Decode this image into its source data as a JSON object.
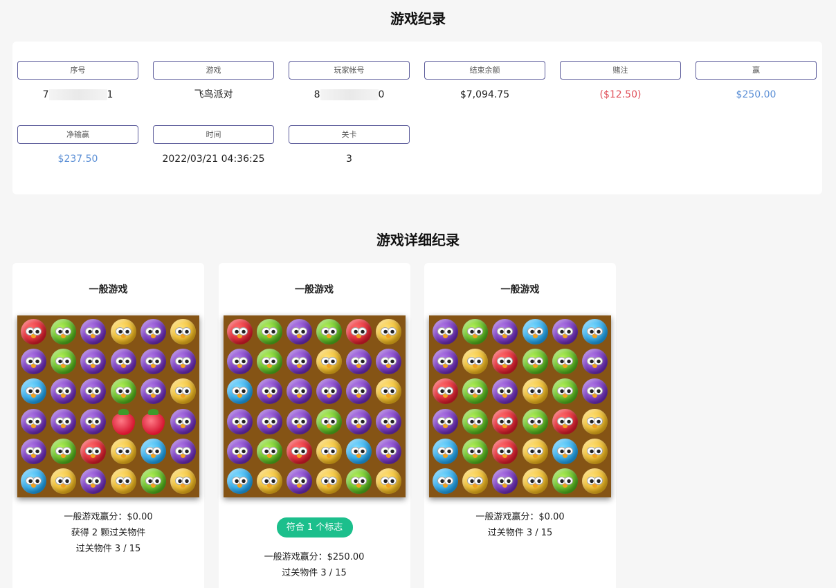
{
  "record_title": "游戏纪录",
  "record": [
    {
      "label": "序号",
      "value_prefix": "7",
      "value_suffix": "1",
      "redacted": true,
      "tone": ""
    },
    {
      "label": "游戏",
      "value": "飞鸟派对",
      "tone": ""
    },
    {
      "label": "玩家帐号",
      "value_prefix": "8",
      "value_suffix": "0",
      "redacted": true,
      "tone": ""
    },
    {
      "label": "结束余额",
      "value": "$7,094.75",
      "tone": ""
    },
    {
      "label": "赌注",
      "value": "($12.50)",
      "tone": "neg"
    },
    {
      "label": "赢",
      "value": "$250.00",
      "tone": "pos"
    },
    {
      "label": "净输赢",
      "value": "$237.50",
      "tone": "pos"
    },
    {
      "label": "时间",
      "value": "2022/03/21 04:36:25",
      "tone": ""
    },
    {
      "label": "关卡",
      "value": "3",
      "tone": ""
    }
  ],
  "detail_title": "游戏详细纪录",
  "rounds": [
    {
      "title": "一般游戏",
      "board": [
        [
          "red",
          "green",
          "purple",
          "yellow",
          "purple",
          "yellow"
        ],
        [
          "purple",
          "green",
          "purple",
          "purple",
          "purple",
          "purple"
        ],
        [
          "blue",
          "purple",
          "purple",
          "green",
          "purple",
          "yellow"
        ],
        [
          "purple",
          "purple",
          "purple",
          "strawberry",
          "strawberry",
          "purple"
        ],
        [
          "purple",
          "green",
          "red",
          "yellow",
          "blue",
          "purple"
        ],
        [
          "blue",
          "yellow",
          "purple",
          "yellow",
          "green",
          "yellow"
        ]
      ],
      "badge": "",
      "lines": [
        "一般游戏赢分：$0.00",
        "获得 2 颗过关物件",
        "过关物件 3 / 15"
      ]
    },
    {
      "title": "一般游戏",
      "board": [
        [
          "red",
          "green",
          "purple",
          "green",
          "red",
          "yellow"
        ],
        [
          "purple",
          "green",
          "purple",
          "yellow",
          "purple",
          "purple"
        ],
        [
          "blue",
          "purple",
          "purple",
          "purple",
          "purple",
          "yellow"
        ],
        [
          "purple",
          "purple",
          "purple",
          "green",
          "purple",
          "purple"
        ],
        [
          "purple",
          "green",
          "red",
          "yellow",
          "blue",
          "purple"
        ],
        [
          "blue",
          "yellow",
          "purple",
          "yellow",
          "green",
          "yellow"
        ]
      ],
      "badge": "符合 1 个标志",
      "lines": [
        "一般游戏赢分：$250.00",
        "过关物件 3 / 15"
      ]
    },
    {
      "title": "一般游戏",
      "board": [
        [
          "purple",
          "green",
          "purple",
          "blue",
          "purple",
          "blue"
        ],
        [
          "purple",
          "yellow",
          "red",
          "green",
          "green",
          "purple"
        ],
        [
          "red",
          "green",
          "purple",
          "yellow",
          "green",
          "purple"
        ],
        [
          "purple",
          "green",
          "red",
          "green",
          "red",
          "yellow"
        ],
        [
          "blue",
          "green",
          "red",
          "yellow",
          "blue",
          "yellow"
        ],
        [
          "blue",
          "yellow",
          "purple",
          "yellow",
          "green",
          "yellow"
        ]
      ],
      "badge": "",
      "lines": [
        "一般游戏赢分：$0.00",
        "过关物件 3 / 15"
      ]
    }
  ]
}
